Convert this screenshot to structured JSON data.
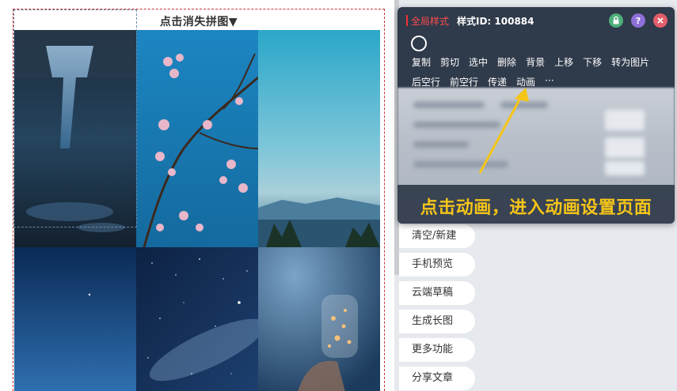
{
  "collage": {
    "title": "点击消失拼图▼",
    "tiles": [
      "rainy-street-photo",
      "blossom-branch-photo",
      "mountain-lake-photo",
      "blue-sky-photo",
      "milky-way-photo",
      "light-bottle-photo"
    ]
  },
  "side_buttons": [
    {
      "label": "清空/新建"
    },
    {
      "label": "手机预览"
    },
    {
      "label": "云端草稿"
    },
    {
      "label": "生成长图"
    },
    {
      "label": "更多功能"
    },
    {
      "label": "分享文章"
    }
  ],
  "style_panel": {
    "global_label": "全局样式",
    "style_id_label": "样式ID: 100884",
    "icons": [
      "lock-icon",
      "help-icon",
      "close-icon"
    ],
    "menu_row1": [
      "复制",
      "剪切",
      "选中",
      "删除",
      "背景",
      "上移",
      "下移",
      "转为图片"
    ],
    "menu_row2": [
      "后空行",
      "前空行",
      "传递",
      "动画",
      "···"
    ],
    "annotation": "点击动画，进入动画设置页面"
  },
  "colors": {
    "panel_bg": "#2f3a4a",
    "annotation": "#f5c518",
    "global_label": "#ff4d4f",
    "lock_icon": "#4caf7a",
    "help_icon": "#8e6fd8",
    "close_icon": "#e35d6a"
  }
}
